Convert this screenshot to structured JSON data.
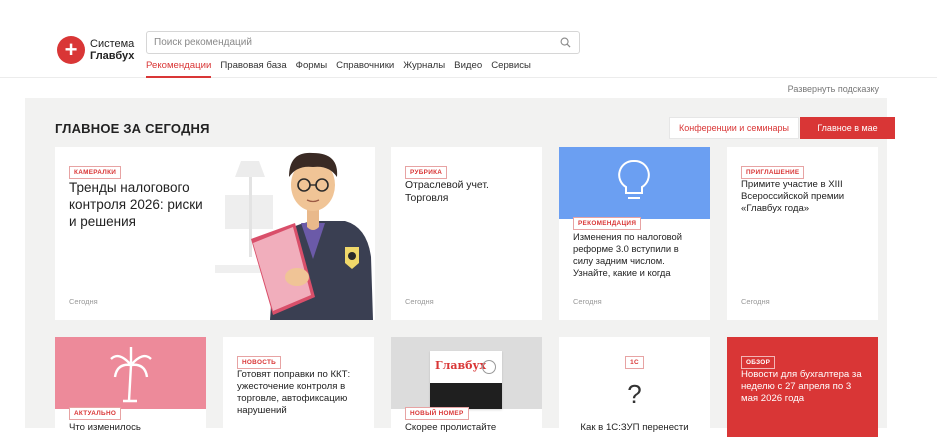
{
  "logo": {
    "line1": "Система",
    "line2": "Главбух"
  },
  "search": {
    "placeholder": "Поиск рекомендаций"
  },
  "nav": [
    "Рекомендации",
    "Правовая база",
    "Формы",
    "Справочники",
    "Журналы",
    "Видео",
    "Сервисы"
  ],
  "hint": "Развернуть подсказку",
  "section": {
    "title": "ГЛАВНОЕ ЗА СЕГОДНЯ",
    "conf_button": "Конференции и семинары",
    "main_button": "Главное в мае"
  },
  "cards": [
    {
      "tag": "КАМЕРАЛКИ",
      "title": "Тренды налогового контроля 2026: риски и решения",
      "date": "Сегодня"
    },
    {
      "tag": "РУБРИКА",
      "title": "Отраслевой учет. Торговля",
      "date": "Сегодня"
    },
    {
      "tag": "РЕКОМЕНДАЦИЯ",
      "title": "Изменения по налоговой реформе 3.0 вступили в силу задним числом. Узнайте, какие и когда",
      "date": "Сегодня"
    },
    {
      "tag": "ПРИГЛАШЕНИЕ",
      "title": "Примите участие в XIII Всероссийской премии «Главбух года»",
      "date": "Сегодня"
    },
    {
      "tag": "АКТУАЛЬНО",
      "title": "Что изменилось"
    },
    {
      "tag": "НОВОСТЬ",
      "title": "Готовят поправки по ККТ: ужесточение контроля в торговле, автофиксацию нарушений"
    },
    {
      "tag": "НОВЫЙ НОМЕР",
      "title": "Скорее пролистайте",
      "magazine": "Главбух"
    },
    {
      "tag": "1С",
      "title": "Как в 1С:ЗУП перенести"
    },
    {
      "tag": "ОБЗОР",
      "title": "Новости для бухгалтера за неделю с 27 апреля по 3 мая 2026 года"
    }
  ],
  "colors": {
    "accent": "#d93636",
    "blue": "#6b9ff2",
    "pink": "#ed8a9a"
  }
}
